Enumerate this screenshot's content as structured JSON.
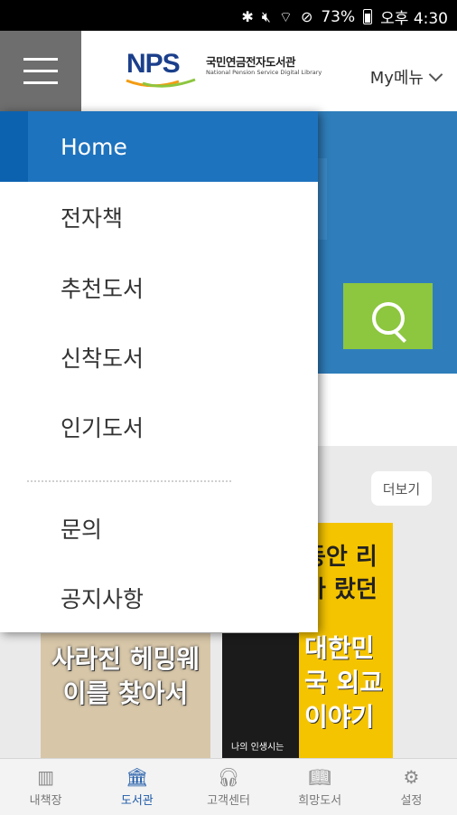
{
  "status_bar": {
    "icons": [
      "bluetooth-icon",
      "mute-icon",
      "wifi-icon",
      "do-not-disturb-icon",
      "battery-icon"
    ],
    "battery": "73%",
    "time": "오후 4:30"
  },
  "header": {
    "logo_mark": "NPS",
    "logo_title": "국민연금전자도서관",
    "logo_subtitle": "National Pension Service Digital Library",
    "my_menu": "My메뉴"
  },
  "drawer": {
    "items": [
      {
        "label": "Home",
        "active": true
      },
      {
        "label": "전자책"
      },
      {
        "label": "추천도서"
      },
      {
        "label": "신착도서"
      },
      {
        "label": "인기도서"
      },
      {
        "label": "문의"
      },
      {
        "label": "공지사항"
      }
    ]
  },
  "content": {
    "more_button": "더보기",
    "books": [
      {
        "title": "사라진 헤밍웨이를 찾아서"
      },
      {
        "subtitle": "나의 인생시는"
      },
      {
        "title": "동안 리가 랐던",
        "title2": "대한민국 외교 이야기"
      }
    ]
  },
  "bottom_nav": {
    "items": [
      {
        "label": "내책장",
        "icon": "bookshelf-icon"
      },
      {
        "label": "도서관",
        "icon": "library-icon",
        "active": true
      },
      {
        "label": "고객센터",
        "icon": "headset-icon"
      },
      {
        "label": "희망도서",
        "icon": "wish-book-icon"
      },
      {
        "label": "설정",
        "icon": "gear-icon"
      }
    ]
  },
  "colors": {
    "accent_blue": "#1e73be",
    "hero_blue": "#2f7ebb",
    "search_green": "#8dc63f",
    "nav_active": "#1f5ba8"
  }
}
